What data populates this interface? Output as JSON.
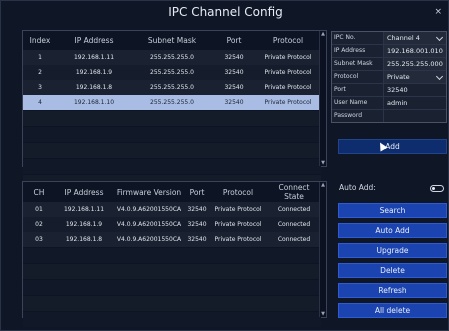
{
  "window": {
    "title": "IPC Channel Config",
    "close_glyph": "×"
  },
  "ipc_table": {
    "headers": [
      "Index",
      "IP Address",
      "Subnet Mask",
      "Port",
      "Protocol"
    ],
    "rows": [
      [
        "1",
        "192.168.1.11",
        "255.255.255.0",
        "32540",
        "Private Protocol"
      ],
      [
        "2",
        "192.168.1.9",
        "255.255.255.0",
        "32540",
        "Private Protocol"
      ],
      [
        "3",
        "192.168.1.8",
        "255.255.255.0",
        "32540",
        "Private Protocol"
      ],
      [
        "4",
        "192.168.1.10",
        "255.255.255.0",
        "32540",
        "Private Protocol"
      ]
    ],
    "selected_index": 3
  },
  "form": {
    "ipc_no": {
      "label": "IPC No.",
      "value": "Channel 4"
    },
    "ip_address": {
      "label": "IP Address",
      "value": "192.168.001.010"
    },
    "subnet_mask": {
      "label": "Subnet Mask",
      "value": "255.255.255.000"
    },
    "protocol": {
      "label": "Protocol",
      "value": "Private"
    },
    "port": {
      "label": "Port",
      "value": "32540"
    },
    "user_name": {
      "label": "User Name",
      "value": "admin"
    },
    "password": {
      "label": "Password",
      "value": ""
    }
  },
  "add_button": "Add",
  "device_table": {
    "headers": [
      "CH",
      "IP Address",
      "Firmware Version",
      "Port",
      "Protocol",
      "Connect State"
    ],
    "rows": [
      [
        "01",
        "192.168.1.11",
        "V4.0.9.A62001550CA",
        "32540",
        "Private Protocol",
        "Connected"
      ],
      [
        "02",
        "192.168.1.9",
        "V4.0.9.A62001550CA",
        "32540",
        "Private Protocol",
        "Connected"
      ],
      [
        "03",
        "192.168.1.8",
        "V4.0.9.A62001550CA",
        "32540",
        "Private Protocol",
        "Connected"
      ]
    ]
  },
  "auto_add": {
    "label": "Auto Add:",
    "enabled": false
  },
  "buttons": {
    "search": "Search",
    "auto_add": "Auto Add",
    "upgrade": "Upgrade",
    "delete": "Delete",
    "refresh": "Refresh",
    "all_delete": "All delete"
  },
  "icons": {
    "scroll_up": "▲",
    "scroll_down": "▼"
  }
}
